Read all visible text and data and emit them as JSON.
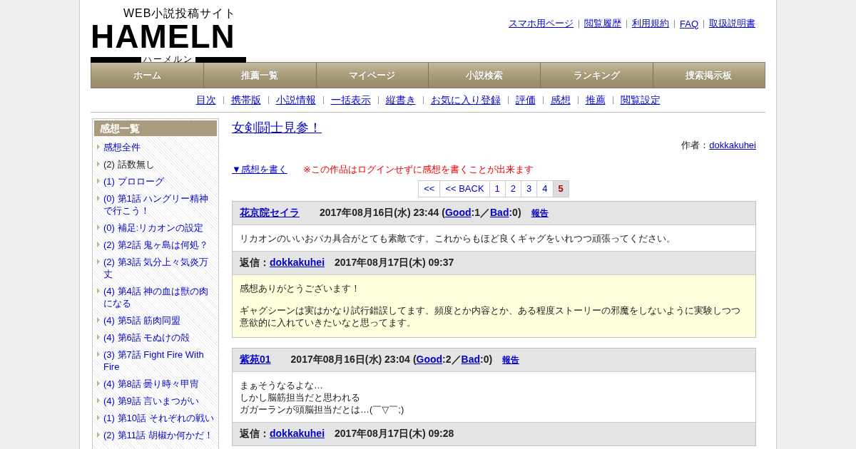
{
  "logo": {
    "tagline": "WEB小説投稿サイト",
    "name": "HAMELN",
    "reading": "ハーメルン"
  },
  "top_links": [
    "スマホ用ページ",
    "閲覧履歴",
    "利用規約",
    "FAQ",
    "取扱説明書"
  ],
  "nav": [
    "ホーム",
    "推薦一覧",
    "マイページ",
    "小説検索",
    "ランキング",
    "捜索掲示板"
  ],
  "sub_nav": [
    "目次",
    "携帯版",
    "小説情報",
    "一括表示",
    "縦書き",
    "お気に入り登録",
    "評価",
    "感想",
    "推薦",
    "閲覧設定"
  ],
  "sidebar": {
    "title": "感想一覧",
    "items": [
      {
        "text": "感想全件",
        "kind": "link"
      },
      {
        "text": "(2) 話数無し",
        "kind": "plain"
      },
      {
        "text": "(1) プロローグ",
        "kind": "link"
      },
      {
        "text": "(0) 第1話 ハングリー精神で行こう！",
        "kind": "link"
      },
      {
        "text": "(0) 補足:リカオンの設定",
        "kind": "link"
      },
      {
        "text": "(2) 第2話 鬼ヶ島は何処？",
        "kind": "link"
      },
      {
        "text": "(2) 第3話 気分上々気炎万丈",
        "kind": "link"
      },
      {
        "text": "(4) 第4話 神の血は獣の肉になる",
        "kind": "link"
      },
      {
        "text": "(4) 第5話 筋肉同盟",
        "kind": "link"
      },
      {
        "text": "(4) 第6話 モぬけの殻",
        "kind": "link"
      },
      {
        "text": "(3) 第7話 Fight Fire With Fire",
        "kind": "link"
      },
      {
        "text": "(4) 第8話 曇り時々甲冑",
        "kind": "link"
      },
      {
        "text": "(4) 第9話 言いまつがい",
        "kind": "link"
      },
      {
        "text": "(1) 第10話 それぞれの戦い",
        "kind": "link"
      },
      {
        "text": "(2) 第11話 胡椒か何かだ！",
        "kind": "link"
      }
    ]
  },
  "novel_title": "女剣闘士見参！",
  "author": {
    "label": "作者：",
    "name": "dokkakuhei"
  },
  "write_link": "▼感想を書く",
  "notice": "※この作品はログインせずに感想を書くことが出来ます",
  "pagination": [
    {
      "label": "<<",
      "selected": false
    },
    {
      "label": "<< BACK",
      "selected": false
    },
    {
      "label": "1",
      "selected": false
    },
    {
      "label": "2",
      "selected": false
    },
    {
      "label": "3",
      "selected": false
    },
    {
      "label": "4",
      "selected": false
    },
    {
      "label": "5",
      "selected": true
    }
  ],
  "comments": [
    {
      "user": "花京院セイラ",
      "date": "2017年08月16日(水) 23:44",
      "votes": [
        {
          "kind": "text",
          "text": "("
        },
        {
          "kind": "link",
          "text": "Good"
        },
        {
          "kind": "text",
          "text": ":1／"
        },
        {
          "kind": "link",
          "text": "Bad"
        },
        {
          "kind": "text",
          "text": ":0)"
        }
      ],
      "report": "報告",
      "body": [
        "リカオンのいいおバカ具合がとても素敵です。これからもほど良くギャグをいれつつ頑張ってください。"
      ],
      "reply": {
        "label": "返信：",
        "user": "dokkakuhei",
        "date": "2017年08月17日(木) 09:37",
        "body": [
          "感想ありがとうございます！",
          "ギャグシーンは実はかなり試行錯誤してます。頻度とか内容とか、ある程度ストーリーの邪魔をしないように実験しつつ意欲的に入れていきたいなと思ってます。"
        ]
      }
    },
    {
      "user": "紫苑01",
      "date": "2017年08月16日(水) 23:04",
      "votes": [
        {
          "kind": "text",
          "text": "("
        },
        {
          "kind": "link",
          "text": "Good"
        },
        {
          "kind": "text",
          "text": ":2／"
        },
        {
          "kind": "link",
          "text": "Bad"
        },
        {
          "kind": "text",
          "text": ":0)"
        }
      ],
      "report": "報告",
      "body": [
        "まぁそうなるよな…",
        "しかし脳筋担当だと思われる",
        "ガガーランが頭脳担当だとは…(￣▽￣;)"
      ],
      "reply": {
        "label": "返信：",
        "user": "dokkakuhei",
        "date": "2017年08月17日(木) 09:28"
      }
    }
  ]
}
